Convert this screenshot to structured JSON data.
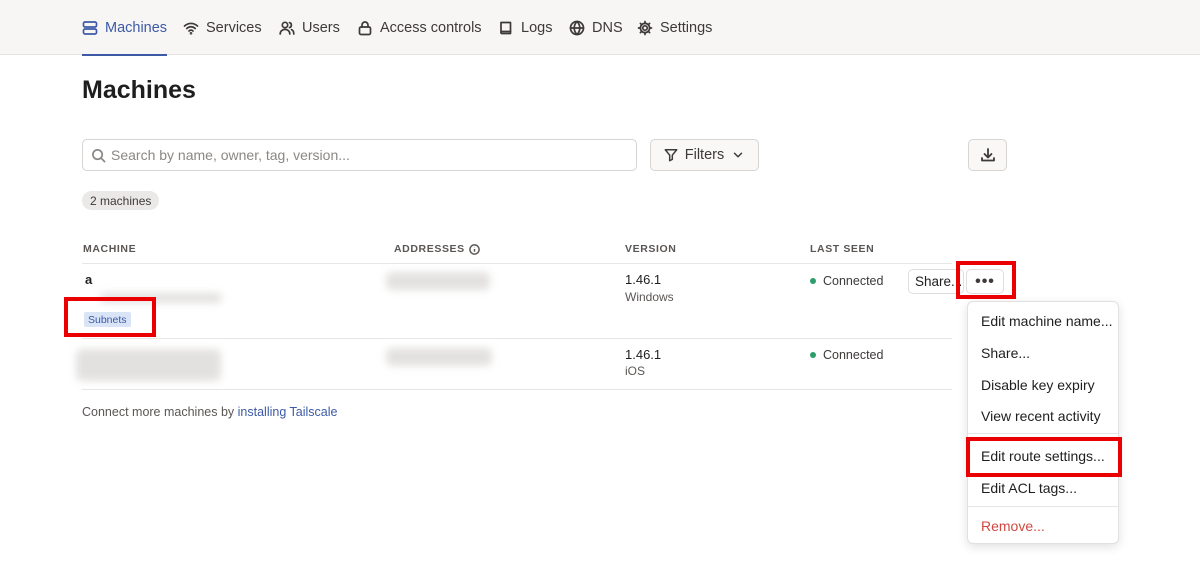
{
  "nav": {
    "items": [
      {
        "label": "Machines",
        "icon": "server-icon",
        "active": true
      },
      {
        "label": "Services",
        "icon": "wifi-icon"
      },
      {
        "label": "Users",
        "icon": "users-icon"
      },
      {
        "label": "Access controls",
        "icon": "lock-icon"
      },
      {
        "label": "Logs",
        "icon": "book-icon"
      },
      {
        "label": "DNS",
        "icon": "globe-icon"
      },
      {
        "label": "Settings",
        "icon": "gear-icon"
      }
    ]
  },
  "page": {
    "title": "Machines"
  },
  "search": {
    "placeholder": "Search by name, owner, tag, version..."
  },
  "filters": {
    "label": "Filters"
  },
  "machine_count": "2 machines",
  "table": {
    "headers": {
      "machine": "MACHINE",
      "addresses": "ADDRESSES",
      "version": "VERSION",
      "last_seen": "LAST SEEN"
    },
    "rows": [
      {
        "name": "a",
        "tag": "Subnets",
        "version": "1.46.1",
        "os": "Windows",
        "status": "Connected",
        "share_label": "Share..."
      },
      {
        "name": "",
        "version": "1.46.1",
        "os": "iOS",
        "status": "Connected"
      }
    ]
  },
  "footer": {
    "prefix": "Connect more machines by ",
    "link": "installing Tailscale"
  },
  "menu": {
    "items": [
      "Edit machine name...",
      "Share...",
      "Disable key expiry",
      "View recent activity",
      "Edit route settings...",
      "Edit ACL tags...",
      "Remove..."
    ]
  },
  "colors": {
    "accent": "#3c5aa6",
    "connected": "#2d9e6b",
    "danger": "#d04841",
    "highlight": "#ea0000"
  }
}
